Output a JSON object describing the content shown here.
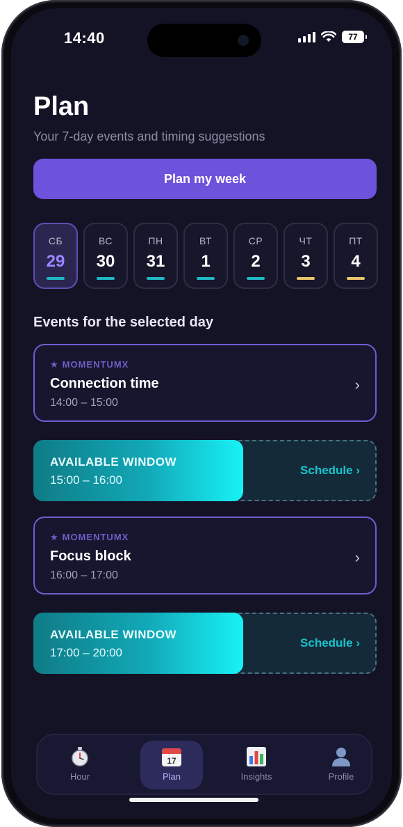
{
  "status_bar": {
    "time": "14:40",
    "battery": "77"
  },
  "header": {
    "title": "Plan",
    "subtitle": "Your 7-day events and timing suggestions",
    "plan_button": "Plan my week"
  },
  "days": [
    {
      "dow": "СБ",
      "num": "29",
      "selected": true,
      "bar_color": "#1fb8c2"
    },
    {
      "dow": "ВС",
      "num": "30",
      "selected": false,
      "bar_color": "#1fb8c2"
    },
    {
      "dow": "ПН",
      "num": "31",
      "selected": false,
      "bar_color": "#1fb8c2"
    },
    {
      "dow": "ВТ",
      "num": "1",
      "selected": false,
      "bar_color": "#1fb8c2"
    },
    {
      "dow": "СР",
      "num": "2",
      "selected": false,
      "bar_color": "#1fb8c2"
    },
    {
      "dow": "ЧТ",
      "num": "3",
      "selected": false,
      "bar_color": "#e8c56a"
    },
    {
      "dow": "ПТ",
      "num": "4",
      "selected": false,
      "bar_color": "#e8c56a"
    }
  ],
  "section_title": "Events for the selected day",
  "events": [
    {
      "tag": "MOMENTUMX",
      "name": "Connection time",
      "time": "14:00 – 15:00"
    },
    {
      "tag": "MOMENTUMX",
      "name": "Focus block",
      "time": "16:00 – 17:00"
    }
  ],
  "windows": [
    {
      "label": "AVAILABLE WINDOW",
      "time": "15:00 – 16:00",
      "action": "Schedule ›"
    },
    {
      "label": "AVAILABLE WINDOW",
      "time": "17:00 – 20:00",
      "action": "Schedule ›"
    }
  ],
  "nav": {
    "items": [
      {
        "label": "Hour",
        "icon": "stopwatch-icon",
        "active": false
      },
      {
        "label": "Plan",
        "icon": "calendar-icon",
        "calendar_day": "17",
        "active": true
      },
      {
        "label": "Insights",
        "icon": "bar-chart-icon",
        "active": false
      },
      {
        "label": "Profile",
        "icon": "person-icon",
        "active": false
      }
    ]
  },
  "colors": {
    "accent": "#6d52dc",
    "teal": "#18f2f6",
    "event_border": "#6b5fcf",
    "background": "#141326"
  }
}
